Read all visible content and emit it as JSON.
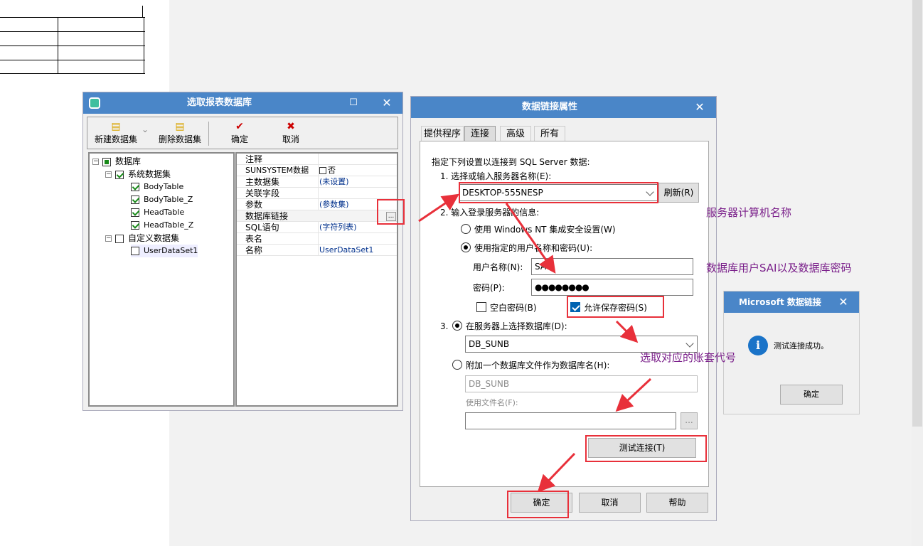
{
  "win1": {
    "title": "选取报表数据库",
    "toolbar": {
      "new_dataset": "新建数据集",
      "delete_dataset": "删除数据集",
      "ok": "确定",
      "cancel": "取消"
    },
    "tree": {
      "root": "数据库",
      "system_group": "系统数据集",
      "system_items": [
        "BodyTable",
        "BodyTable_Z",
        "HeadTable",
        "HeadTable_Z"
      ],
      "custom_group": "自定义数据集",
      "custom_items": [
        "UserDataSet1"
      ]
    },
    "props": [
      {
        "name": "注释",
        "value": ""
      },
      {
        "name": "SUNSYSTEM数据",
        "value": "否"
      },
      {
        "name": "主数据集",
        "value": "(未设置)"
      },
      {
        "name": "关联字段",
        "value": ""
      },
      {
        "name": "参数",
        "value": "(参数集)"
      },
      {
        "name": "数据库链接",
        "value": ""
      },
      {
        "name": "SQL语句",
        "value": "(字符列表)"
      },
      {
        "name": "表名",
        "value": ""
      },
      {
        "name": "名称",
        "value": "UserDataSet1"
      }
    ],
    "ellipsis": "..."
  },
  "win2": {
    "title": "数据链接属性",
    "tabs": [
      "提供程序",
      "连接",
      "高级",
      "所有"
    ],
    "active_tab": "连接",
    "intro": "指定下列设置以连接到 SQL Server 数据:",
    "step1": "1. 选择或输入服务器名称(E):",
    "server_value": "DESKTOP-555NESP",
    "refresh": "刷新(R)",
    "step2": "2. 输入登录服务器的信息:",
    "opt_windows_nt": "使用 Windows NT 集成安全设置(W)",
    "opt_user_pass": "使用指定的用户名称和密码(U):",
    "username_label": "用户名称(N):",
    "username_value": "SA",
    "password_label": "密码(P):",
    "password_value": "●●●●●●●●",
    "blank_password": "空白密码(B)",
    "allow_save_password": "允许保存密码(S)",
    "step3_num": "3.",
    "opt_select_db": "在服务器上选择数据库(D):",
    "db_value": "DB_SUNB",
    "opt_attach_db": "附加一个数据库文件作为数据库名(H):",
    "attach_db_value": "DB_SUNB",
    "use_filename": "使用文件名(F):",
    "ellipsis": "...",
    "test_connection": "测试连接(T)",
    "ok": "确定",
    "cancel": "取消",
    "help": "帮助"
  },
  "win3": {
    "title": "Microsoft 数据链接",
    "message": "测试连接成功。",
    "ok": "确定"
  },
  "annotations": {
    "server_name_note": "服务器计算机名称",
    "db_user_note": "数据库用户SAI以及数据库密码",
    "select_account_note": "选取对应的账套代号"
  },
  "colors": {
    "title_bar": "#4a86c8",
    "highlight": "#e8303a",
    "note_text": "#7a1f8a"
  }
}
